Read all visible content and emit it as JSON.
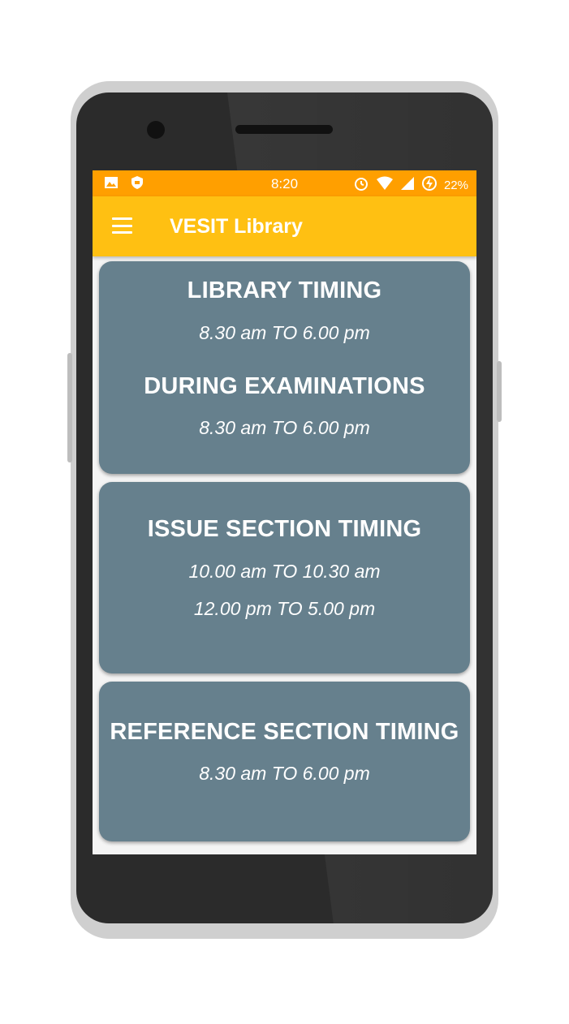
{
  "status_bar": {
    "time": "8:20",
    "battery": "22%",
    "left_icons": [
      "image-icon",
      "shield-icon"
    ],
    "right_icons": [
      "alarm-icon",
      "wifi-icon",
      "signal-icon",
      "battery-charging-icon"
    ]
  },
  "toolbar": {
    "title": "VESIT Library",
    "menu_icon": "hamburger-menu-icon"
  },
  "cards": [
    {
      "title": "LIBRARY TIMING",
      "time": "8.30 am TO 6.00 pm",
      "subtitle": "DURING EXAMINATIONS",
      "subtime": "8.30 am TO 6.00 pm"
    },
    {
      "title": "ISSUE SECTION TIMING",
      "times": [
        "10.00 am TO 10.30 am",
        "12.00 pm TO 5.00 pm"
      ]
    },
    {
      "title": "REFERENCE SECTION TIMING",
      "time": "8.30 am TO 6.00 pm"
    }
  ],
  "colors": {
    "status_bar": "#ff9f00",
    "toolbar": "#ffc012",
    "card": "#66808d"
  }
}
